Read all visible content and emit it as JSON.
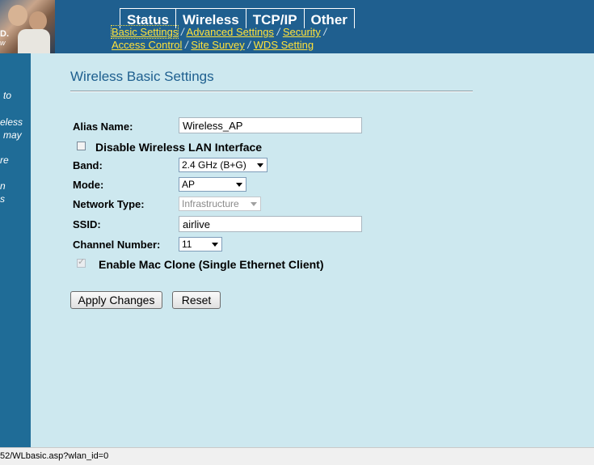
{
  "logo": {
    "mark": "D.",
    "tagline": "w"
  },
  "tabs": [
    {
      "label": "Status"
    },
    {
      "label": "Wireless"
    },
    {
      "label": "TCP/IP"
    },
    {
      "label": "Other"
    }
  ],
  "subnav": {
    "row1": [
      "Basic Settings",
      "Advanced Settings",
      "Security"
    ],
    "row2": [
      "Access Control",
      "Site Survey",
      "WDS Setting"
    ],
    "separator": "/"
  },
  "leftnav": {
    "fragments": [
      "to",
      "eless",
      "may",
      "re",
      "n",
      "s"
    ]
  },
  "page": {
    "title": "Wireless Basic Settings"
  },
  "form": {
    "alias_label": "Alias Name:",
    "alias_value": "Wireless_AP",
    "disable_wlan_label": "Disable Wireless LAN Interface",
    "band_label": "Band:",
    "band_value": "2.4 GHz (B+G)",
    "mode_label": "Mode:",
    "mode_value": "AP",
    "network_type_label": "Network Type:",
    "network_type_value": "Infrastructure",
    "ssid_label": "SSID:",
    "ssid_value": "airlive",
    "channel_label": "Channel Number:",
    "channel_value": "11",
    "mac_clone_label": "Enable Mac Clone (Single Ethernet Client)"
  },
  "buttons": {
    "apply": "Apply Changes",
    "reset": "Reset"
  },
  "statusbar": {
    "text": "52/WLbasic.asp?wlan_id=0"
  },
  "colors": {
    "header_bg": "#1f5f8f",
    "link_yellow": "#ffe23a",
    "content_bg": "#cde8ef",
    "title_blue": "#1e5f8f"
  }
}
